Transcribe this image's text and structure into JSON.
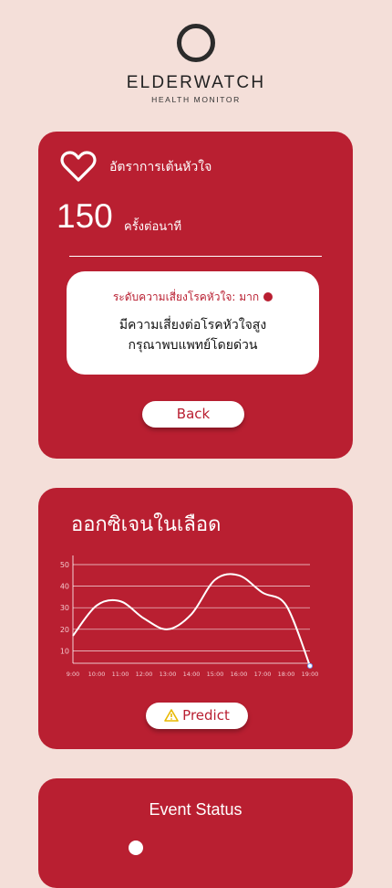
{
  "brand": {
    "name": "ELDERWATCH",
    "tagline": "HEALTH MONITOR"
  },
  "heart_rate": {
    "label": "อัตราการเต้นหัวใจ",
    "value": "150",
    "unit": "ครั้งต่อนาที",
    "risk_level": "ระดับความเสี่ยงโรคหัวใจ: มาก",
    "message_line1": "มีความเสี่ยงต่อโรคหัวใจสูง",
    "message_line2": "กรุณาพบแพทย์โดยด่วน",
    "back_label": "Back"
  },
  "oxygen": {
    "title": "ออกซิเจนในเลือด",
    "predict_label": "Predict"
  },
  "event": {
    "title": "Event Status"
  },
  "colors": {
    "card": "#b91f31",
    "background": "#f4dfd9",
    "warning": "#f2c200"
  },
  "chart_data": {
    "type": "line",
    "x": [
      "9:00",
      "10:00",
      "11:00",
      "12:00",
      "13:00",
      "14:00",
      "15:00",
      "16:00",
      "17:00",
      "18:00",
      "19:00"
    ],
    "y_ticks": [
      10,
      20,
      30,
      40,
      50
    ],
    "ylim": [
      0,
      50
    ],
    "grid": true,
    "series": [
      {
        "values": [
          17,
          31,
          33,
          25,
          20,
          27,
          43,
          45,
          37,
          31,
          3
        ]
      }
    ]
  }
}
